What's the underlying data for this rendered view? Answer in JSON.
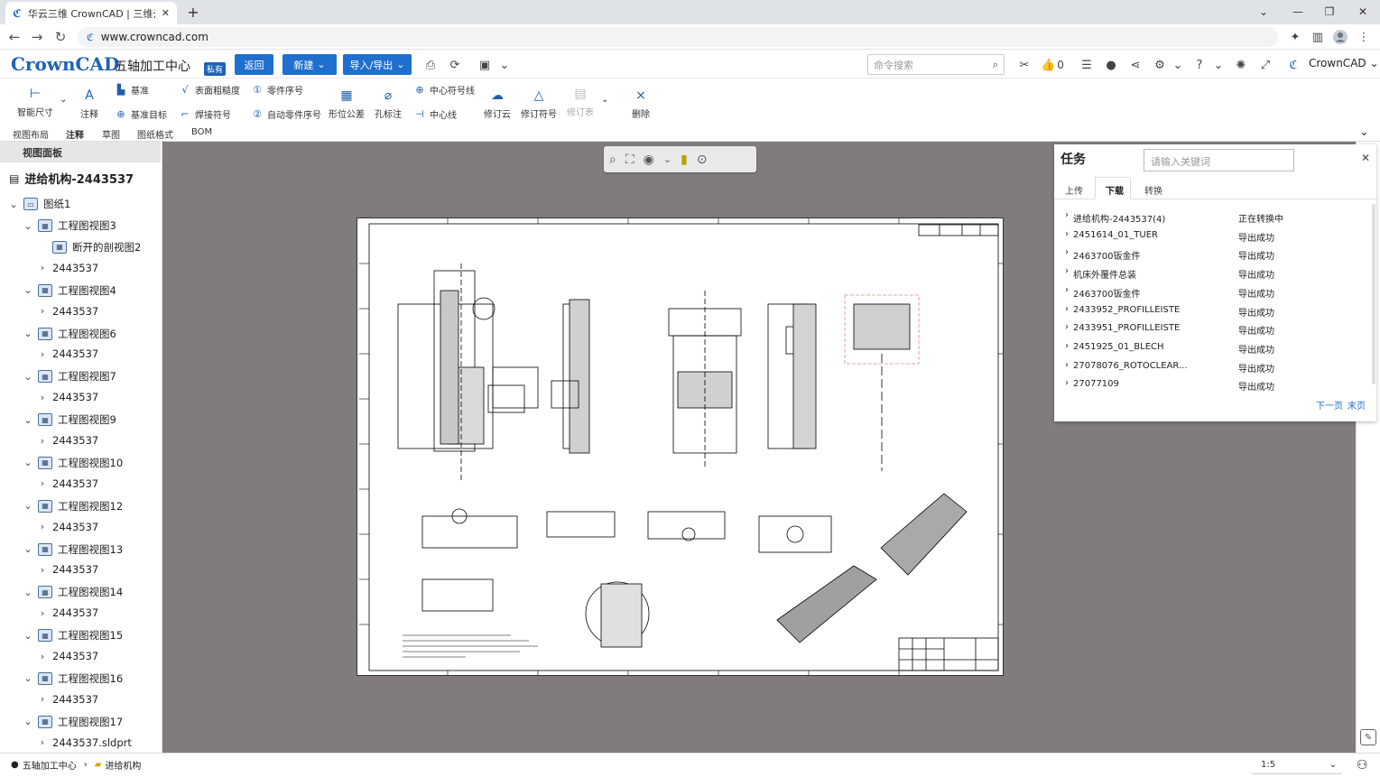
{
  "browser": {
    "tab_title": "华云三维 CrownCAD | 三维云CA",
    "url": "www.crowncad.com"
  },
  "header": {
    "logo": "CrownCAD",
    "project": "五轴加工中心",
    "private_badge": "私有",
    "back_label": "返回",
    "new_label": "新建",
    "import_export_label": "导入/导出",
    "search_placeholder": "命令搜索",
    "like_count": "0",
    "user": "CrownCAD"
  },
  "ribbon": {
    "smart_dim": "智能尺寸",
    "note": "注释",
    "datum": "基准",
    "datum_target": "基准目标",
    "surface_roughness": "表面粗糙度",
    "weld_symbol": "焊接符号",
    "part_number": "零件序号",
    "auto_part_number": "自动零件序号",
    "gdt": "形位公差",
    "hole_callout": "孔标注",
    "center_mark": "中心符号线",
    "centerline": "中心线",
    "revision_cloud": "修订云",
    "revision_symbol": "修订符号",
    "revision_table": "修订表",
    "delete": "删除"
  },
  "ribbon_tabs": [
    "视图布局",
    "注释",
    "草图",
    "图纸格式",
    "BOM"
  ],
  "sidebar": {
    "panel_title": "视图面板",
    "root": "进给机构-2443537",
    "sheet": "图纸1",
    "nodes": [
      {
        "label": "工程图视图3",
        "level": 1
      },
      {
        "label": "断开的剖视图2",
        "level": 2
      },
      {
        "label": "2443537",
        "level": 2
      },
      {
        "label": "工程图视图4",
        "level": 1
      },
      {
        "label": "2443537",
        "level": 2
      },
      {
        "label": "工程图视图6",
        "level": 1
      },
      {
        "label": "2443537",
        "level": 2
      },
      {
        "label": "工程图视图7",
        "level": 1
      },
      {
        "label": "2443537",
        "level": 2
      },
      {
        "label": "工程图视图9",
        "level": 1
      },
      {
        "label": "2443537",
        "level": 2
      },
      {
        "label": "工程图视图10",
        "level": 1
      },
      {
        "label": "2443537",
        "level": 2
      },
      {
        "label": "工程图视图12",
        "level": 1
      },
      {
        "label": "2443537",
        "level": 2
      },
      {
        "label": "工程图视图13",
        "level": 1
      },
      {
        "label": "2443537",
        "level": 2
      },
      {
        "label": "工程图视图14",
        "level": 1
      },
      {
        "label": "2443537",
        "level": 2
      },
      {
        "label": "工程图视图15",
        "level": 1
      },
      {
        "label": "2443537",
        "level": 2
      },
      {
        "label": "工程图视图16",
        "level": 1
      },
      {
        "label": "2443537",
        "level": 2
      },
      {
        "label": "工程图视图17",
        "level": 1
      },
      {
        "label": "2443537.sldprt",
        "level": 2
      }
    ]
  },
  "task_panel": {
    "title": "任务",
    "keyword_placeholder": "请输入关键词",
    "tabs": [
      "上传",
      "下载",
      "转换"
    ],
    "active_tab": "下载",
    "rows": [
      {
        "name": "进给机构-2443537(4)",
        "status": "正在转换中"
      },
      {
        "name": "2451614_01_TUER",
        "status": "导出成功"
      },
      {
        "name": "2463700钣金件",
        "status": "导出成功"
      },
      {
        "name": "机床外覆件总装",
        "status": "导出成功"
      },
      {
        "name": "2463700钣金件",
        "status": "导出成功"
      },
      {
        "name": "2433952_PROFILLEISTE",
        "status": "导出成功"
      },
      {
        "name": "2433951_PROFILLEISTE",
        "status": "导出成功"
      },
      {
        "name": "2451925_01_BLECH",
        "status": "导出成功"
      },
      {
        "name": "27078076_ROTOCLEAR...",
        "status": "导出成功"
      },
      {
        "name": "27077109",
        "status": "导出成功"
      }
    ],
    "next_page": "下一页",
    "last_page": "末页"
  },
  "status_bar": {
    "breadcrumb_root": "五轴加工中心",
    "breadcrumb_current": "进给机构",
    "scale": "1:5"
  },
  "colors": {
    "brand": "#1f63b7",
    "canvas_bg": "#817c7b"
  }
}
